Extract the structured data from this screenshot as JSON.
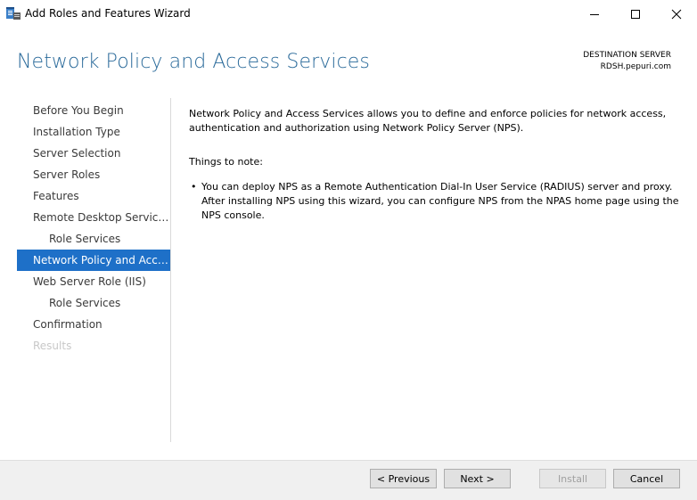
{
  "window": {
    "title": "Add Roles and Features Wizard",
    "icon": "server-manager-icon",
    "controls": [
      "minimize-icon",
      "maximize-icon",
      "close-icon"
    ]
  },
  "header": {
    "page_title": "Network Policy and Access Services",
    "destination_label": "DESTINATION SERVER",
    "destination_server": "RDSH.pepuri.com"
  },
  "nav": {
    "items": [
      {
        "label": "Before You Begin",
        "state": "normal"
      },
      {
        "label": "Installation Type",
        "state": "normal"
      },
      {
        "label": "Server Selection",
        "state": "normal"
      },
      {
        "label": "Server Roles",
        "state": "normal"
      },
      {
        "label": "Features",
        "state": "normal"
      },
      {
        "label": "Remote Desktop Services",
        "state": "normal"
      },
      {
        "label": "Role Services",
        "state": "sub"
      },
      {
        "label": "Network Policy and Acces...",
        "state": "active"
      },
      {
        "label": "Web Server Role (IIS)",
        "state": "normal"
      },
      {
        "label": "Role Services",
        "state": "sub"
      },
      {
        "label": "Confirmation",
        "state": "normal"
      },
      {
        "label": "Results",
        "state": "disabled"
      }
    ]
  },
  "content": {
    "intro_line1": "Network Policy and Access Services allows you to define and enforce policies for network access,",
    "intro_line2": "authentication and authorization using Network Policy Server (NPS).",
    "notes_heading": "Things to note:",
    "bullet1_line1": "You can deploy NPS as a Remote Authentication Dial-In User Service (RADIUS) server and proxy.",
    "bullet1_line2": "After installing NPS using this wizard,  you can configure NPS from the NPAS home page using the",
    "bullet1_line3": "NPS console.",
    "bullet_glyph": "•"
  },
  "footer": {
    "previous_label": "< Previous",
    "next_label": "Next >",
    "install_label": "Install",
    "cancel_label": "Cancel"
  },
  "colors": {
    "accent": "#1e70c8",
    "title_blue": "#2a6a9a",
    "footer_bg": "#f0f0f0"
  }
}
